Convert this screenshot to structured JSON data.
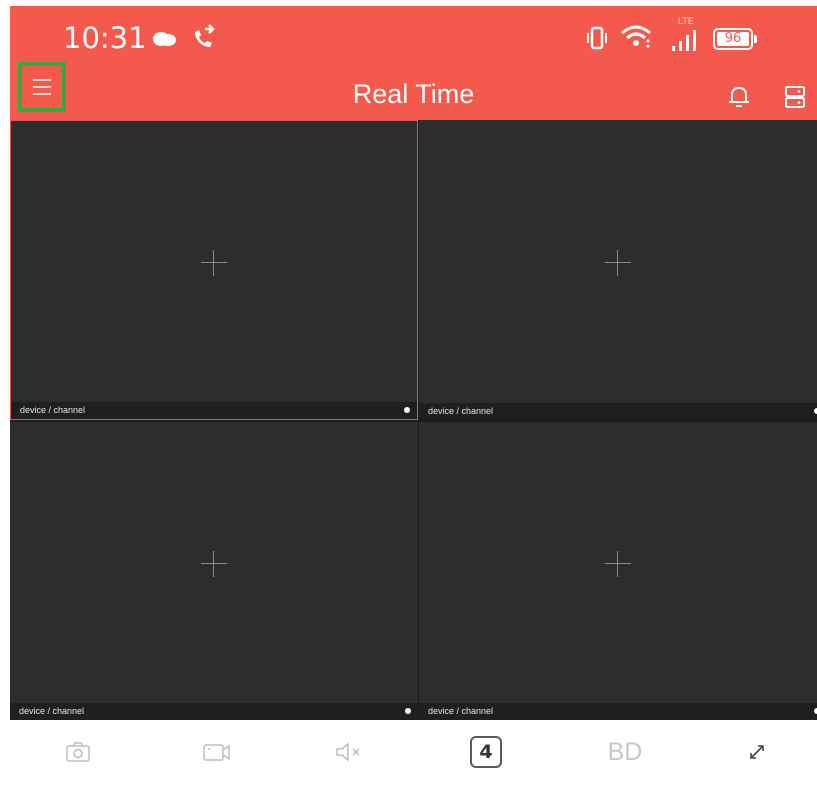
{
  "status_bar": {
    "time": "10:31",
    "network_label": "LTE",
    "battery": "96"
  },
  "header": {
    "title": "Real Time",
    "background": "#f4594e"
  },
  "channels": [
    {
      "label": "device / channel",
      "active": true
    },
    {
      "label": "device / channel",
      "active": false
    },
    {
      "label": "device / channel",
      "active": false
    },
    {
      "label": "device / channel",
      "active": false
    }
  ],
  "toolbar": {
    "split_count": "4",
    "quality": "BD",
    "icons": [
      "camera-icon",
      "record-video-icon",
      "speaker-mute-icon",
      "split-screen-button",
      "quality-toggle",
      "fullscreen-icon"
    ]
  },
  "colors": {
    "accent": "#f4594e",
    "menu_highlight": "#3aa83a",
    "cell_bg": "#2d2d2d"
  }
}
